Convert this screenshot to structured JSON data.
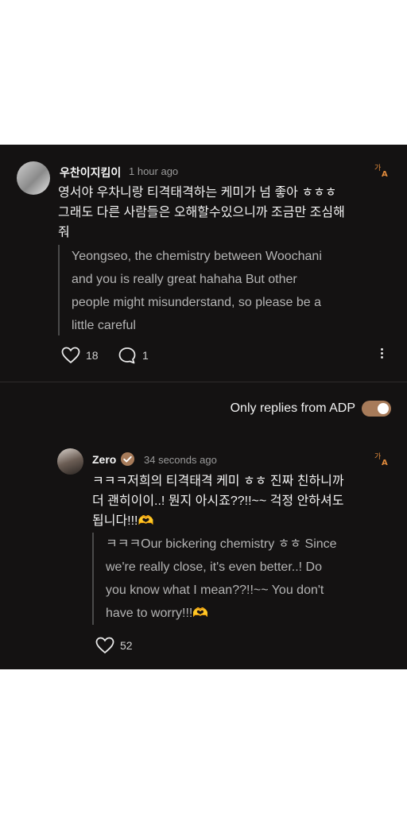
{
  "comment1": {
    "username": "우찬이지킴이",
    "time": "1 hour ago",
    "text_line1": "영서야 우차니랑 티격태격하는 케미가 넘 좋아 ㅎㅎㅎ",
    "text_line2": "그래도 다른 사람들은 오해할수있으니까 조금만 조심해",
    "text_line3": "줘",
    "translation_line1": "Yeongseo, the chemistry between Woochani",
    "translation_line2": "and you is really great hahaha But other",
    "translation_line3": "people might misunderstand, so please be a",
    "translation_line4": "little careful",
    "likes": "18",
    "replies": "1"
  },
  "filter": {
    "label": "Only replies from ADP",
    "enabled": true
  },
  "reply": {
    "username": "Zero",
    "time": "34 seconds ago",
    "text_line1": "ㅋㅋㅋ저희의  티격태격 케미 ㅎㅎ 진짜 친하니까",
    "text_line2": "더 괜히이이..! 뭔지 아시죠??!!~~ 걱정 안하셔도",
    "text_line3": "됩니다!!!🫶",
    "translation_line1": "ㅋㅋㅋOur bickering chemistry ㅎㅎ Since",
    "translation_line2": "we're really close, it's even better..! Do",
    "translation_line3": "you know what I mean??!!~~ You don't",
    "translation_line4": "have to worry!!!🫶",
    "likes": "52"
  },
  "colors": {
    "background": "#141212",
    "accent": "#a77b5a",
    "translate_icon": "#e08a3c"
  }
}
